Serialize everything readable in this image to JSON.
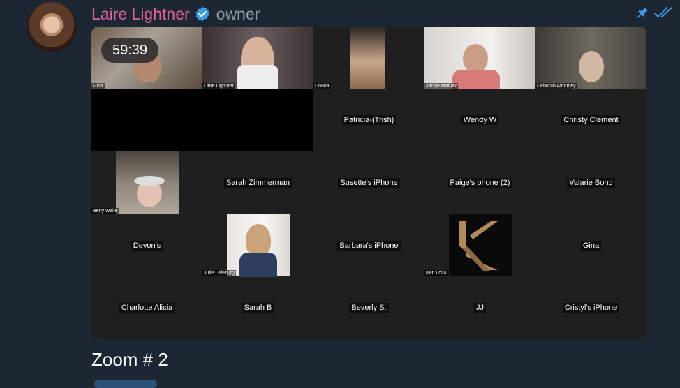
{
  "message": {
    "sender": "Laire Lightner",
    "role": "owner",
    "caption": "Zoom # 2"
  },
  "icons": {
    "avatar": "profile-avatar",
    "verified": "verified-badge-icon",
    "pin": "pin-icon",
    "read": "double-check-icon"
  },
  "colors": {
    "background": "#1d2733",
    "sender": "#e0619a",
    "verified": "#3d9ce8",
    "pin": "#3d9ce8",
    "role": "#8f9aa6"
  },
  "zoom": {
    "timer": "59:39",
    "video_tiles": [
      {
        "name": "Gina"
      },
      {
        "name": "Laire Lightner"
      },
      {
        "name": "Donna"
      },
      {
        "name": "Jackie Marvitz"
      },
      {
        "name": "Deborah Almoney"
      },
      {
        "name": "Betty Waite"
      },
      {
        "name": "Julie Lefeburg"
      },
      {
        "name": "Ken Lolla"
      }
    ],
    "name_tiles": [
      {
        "name": "Patricia-(Trish)"
      },
      {
        "name": "Wendy W"
      },
      {
        "name": "Christy Clement"
      },
      {
        "name": "Sarah Zimmerman"
      },
      {
        "name": "Susette's iPhone"
      },
      {
        "name": "Paige's phone (2)"
      },
      {
        "name": "Valarie Bond"
      },
      {
        "name": "Devon's"
      },
      {
        "name": "Barbara's iPhone"
      },
      {
        "name": "Gina"
      },
      {
        "name": "Charlotte Alicia"
      },
      {
        "name": "Sarah B"
      },
      {
        "name": "Beverly S."
      },
      {
        "name": "JJ"
      },
      {
        "name": "Cristyl's iPhone"
      }
    ]
  }
}
